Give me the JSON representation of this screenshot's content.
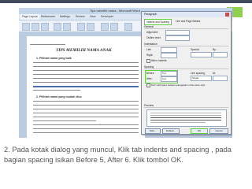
{
  "window": {
    "title": "Tips memilih nama - Microsoft Word"
  },
  "ribbon_tabs": [
    "Page Layout",
    "References",
    "Mailings",
    "Review",
    "View",
    "Developer"
  ],
  "document": {
    "title": "TIPS MEMILIH NAMA ANAK",
    "heading1": "1.   Pilihlah nama yang baik",
    "heading2": "2.   Pilihlah nama yang mudah diuc"
  },
  "dialog": {
    "title": "Paragraph",
    "tabs": [
      "Indents and Spacing",
      "Line and Page Breaks"
    ],
    "general_label": "General",
    "alignment_label": "Alignment:",
    "outline_label": "Outline level:",
    "indentation_label": "Indentation",
    "left_label": "Left:",
    "right_label": "Right:",
    "special_label": "Special:",
    "by_label": "By:",
    "mirror_label": "Mirror indents",
    "spacing_label": "Spacing",
    "before_label": "Before:",
    "after_label": "After:",
    "before_value": "5 pt",
    "after_value": "6 pt",
    "line_spacing_label": "Line spacing:",
    "line_spacing_value": "Single",
    "at_label": "At:",
    "dont_add_label": "Don't add space between paragraphs of the same style",
    "preview_label": "Preview",
    "buttons": {
      "tabs": "Tabs...",
      "default": "Default...",
      "ok": "OK",
      "cancel": "Cancel"
    }
  },
  "caption": "2. Pada kotak dialog yang muncul, Klik tab indents and spacing , pada bagian spacing isikan Before 5, After 6. Klik tombol OK.",
  "colors": {
    "highlight": "#5fcf3f",
    "accent": "#8fd14f",
    "topbar": "#3f4b5c"
  }
}
